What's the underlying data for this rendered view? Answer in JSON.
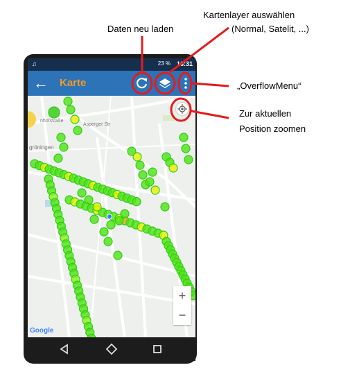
{
  "annotations": {
    "reload": "Daten neu laden",
    "layer_line1": "Kartenlayer auswählen",
    "layer_line2": "(Normal, Satelit, ...)",
    "overflow": "„OverflowMenu“",
    "zoom_line1": "Zur aktuellen",
    "zoom_line2": "Position zoomen"
  },
  "status_bar": {
    "left_icon": "music-note-icon",
    "battery": "23 %",
    "time": "16:31"
  },
  "app_bar": {
    "title": "Karte",
    "back_icon": "arrow-left-icon",
    "reload_icon": "refresh-icon",
    "layers_icon": "layers-icon",
    "overflow_icon": "overflow-menu-icon"
  },
  "map": {
    "street_labels": [
      "nhofstraße",
      "Asperger Str",
      "gröningen"
    ],
    "zoom_in": "+",
    "zoom_out": "−",
    "attribution": "Google",
    "location_button_icon": "my-location-icon"
  },
  "nav_bar": {
    "back_icon": "nav-back-icon",
    "home_icon": "nav-home-icon",
    "recents_icon": "nav-recents-icon"
  },
  "colors": {
    "highlight": "#e51b1b",
    "appbar": "#2c73b8",
    "title": "#f29a23",
    "marker_green": "#4ee414",
    "marker_yellow": "#e8f000"
  }
}
